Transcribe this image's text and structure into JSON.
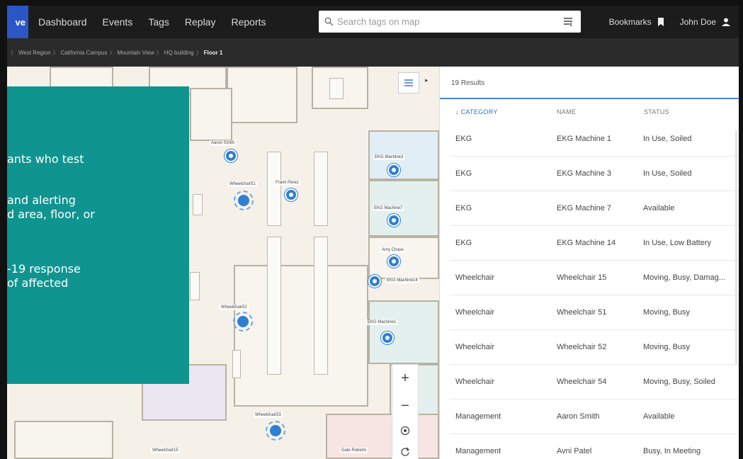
{
  "nav": {
    "brand": "ve",
    "items": [
      "Dashboard",
      "Events",
      "Tags",
      "Replay",
      "Reports"
    ],
    "search_placeholder": "Search tags on map",
    "bookmarks": "Bookmarks",
    "user": "John Doe"
  },
  "breadcrumb": [
    "West Region",
    "California Campus",
    "Mountain View",
    "HQ building",
    "Floor 1"
  ],
  "overlay": {
    "lines": [
      "ants who test",
      "and alerting",
      "d area, floor, or",
      "-19 response",
      "of affected"
    ]
  },
  "map": {
    "labels": [
      "Aaron Smith",
      "Wheelchair51",
      "Frank Perez",
      "EKG Machine3",
      "EKG Machine7",
      "Amy Chase",
      "EKG Machine14",
      "Wheelchair52",
      "EKG Machine1",
      "Wheelchair53",
      "Wheelchair15",
      "Gale Roberts"
    ],
    "zoom_in": "+",
    "zoom_out": "−"
  },
  "results": {
    "count": "19 Results",
    "columns": [
      "↓ CATEGORY",
      "NAME",
      "STATUS"
    ],
    "rows": [
      [
        "EKG",
        "EKG Machine 1",
        "In Use, Soiled"
      ],
      [
        "EKG",
        "EKG Machine 3",
        "In Use, Soiled"
      ],
      [
        "EKG",
        "EKG Machine 7",
        "Available"
      ],
      [
        "EKG",
        "EKG Machine 14",
        "In Use, Low Battery"
      ],
      [
        "Wheelchair",
        "Wheelchair 15",
        "Moving, Busy, Damag..."
      ],
      [
        "Wheelchair",
        "Wheelchair 51",
        "Moving, Busy"
      ],
      [
        "Wheelchair",
        "Wheelchair 52",
        "Moving, Busy"
      ],
      [
        "Wheelchair",
        "Wheelchair 54",
        "Moving, Busy, Soiled"
      ],
      [
        "Management",
        "Aaron Smith",
        "Available"
      ],
      [
        "Management",
        "Avni Patel",
        "Busy, In Meeting"
      ]
    ]
  },
  "colors": {
    "overlay": "#0f9490",
    "accent": "#2f7fd3",
    "topbar": "#1c1c1c"
  }
}
